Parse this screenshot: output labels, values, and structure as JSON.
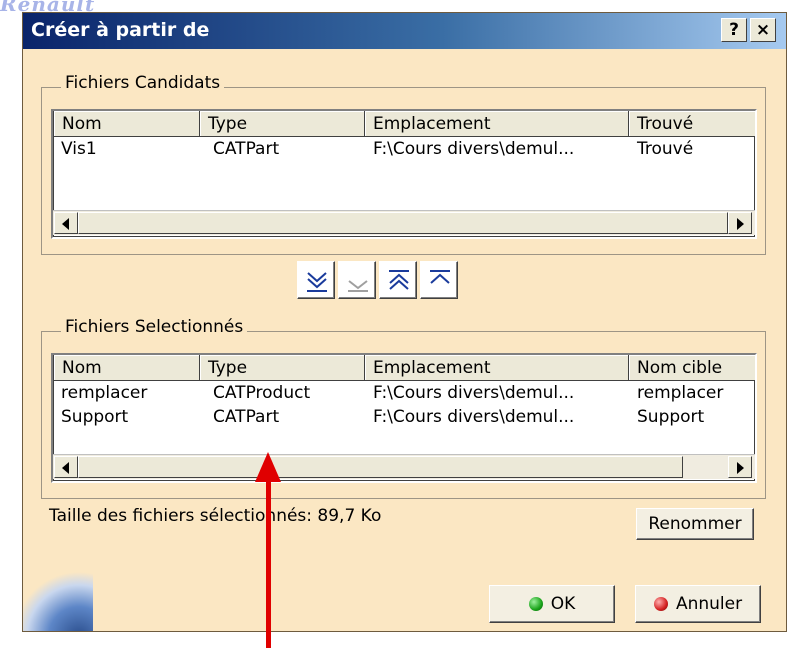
{
  "background_logo": "Renault",
  "window": {
    "title": "Créer à partir de",
    "help_label": "?",
    "close_label": "×"
  },
  "candidates": {
    "group_label": "Fichiers Candidats",
    "columns": [
      "Nom",
      "Type",
      "Emplacement",
      "Trouvé"
    ],
    "rows": [
      [
        "Vis1",
        "CATPart",
        "F:\\Cours divers\\demul...",
        "Trouvé"
      ]
    ]
  },
  "toolbar": {
    "icons": [
      "select-all-down-icon",
      "select-down-icon",
      "deselect-all-up-icon",
      "deselect-up-icon"
    ]
  },
  "selected": {
    "group_label": "Fichiers Selectionnés",
    "columns": [
      "Nom",
      "Type",
      "Emplacement",
      "Nom cible"
    ],
    "rows": [
      [
        "remplacer",
        "CATProduct",
        "F:\\Cours divers\\demul...",
        "remplacer"
      ],
      [
        "Support",
        "CATPart",
        "F:\\Cours divers\\demul...",
        "Support"
      ]
    ]
  },
  "size_label": "Taille des fichiers sélectionnés: 89,7 Ko",
  "buttons": {
    "rename": "Renommer",
    "ok": "OK",
    "cancel": "Annuler"
  },
  "colors": {
    "dialog_bg": "#fbe7c3",
    "title_bar": "#0a246a",
    "annotation_arrow": "#e00000",
    "ok_dot": "#1aa31a",
    "cancel_dot": "#d42020"
  }
}
